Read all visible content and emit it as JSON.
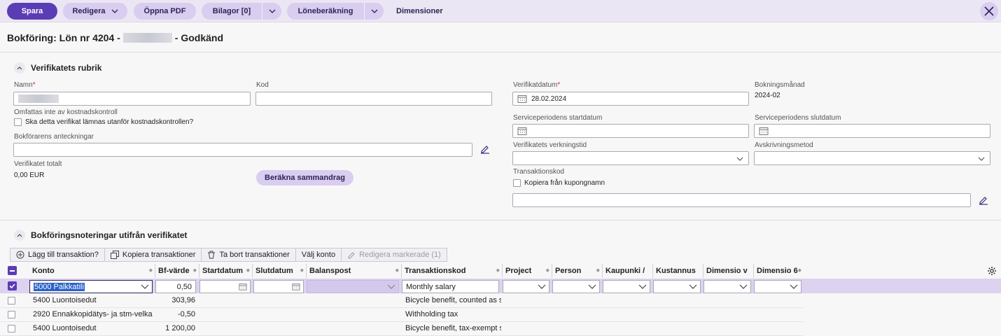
{
  "toolbar": {
    "save": "Spara",
    "edit": "Redigera",
    "open_pdf": "Öppna PDF",
    "attachments": "Bilagor [0]",
    "salary_calc": "Löneberäkning",
    "dimensions": "Dimensioner"
  },
  "page": {
    "title_prefix": "Bokföring: Lön nr 4204 -",
    "title_suffix": "- Godkänd"
  },
  "header_section": {
    "title": "Verifikatets rubrik",
    "name_label": "Namn",
    "code_label": "Kod",
    "code_value": "",
    "cost_control_label": "Omfattas inte av kostnadskontroll",
    "cost_control_checkbox": "Ska detta verifikat lämnas utanför kostnadskontrollen?",
    "notes_label": "Bokförarens anteckningar",
    "notes_value": "",
    "total_label": "Verifikatet totalt",
    "total_value": "0,00 EUR",
    "calc_summary": "Beräkna sammandrag",
    "voucher_date_label": "Verifikatdatum",
    "voucher_date_value": "28.02.2024",
    "booking_month_label": "Bokningsmånad",
    "booking_month_value": "2024-02",
    "service_start_label": "Serviceperiodens startdatum",
    "service_end_label": "Serviceperiodens slutdatum",
    "effect_time_label": "Verifikatets verkningstid",
    "depreciation_label": "Avskrivningsmetod",
    "transaction_code_label": "Transaktionskod",
    "copy_coupon_label": "Kopiera från kupongnamn",
    "transaction_code_value": ""
  },
  "entries_section": {
    "title": "Bokföringsnoteringar utifrån verifikatet",
    "buttons": {
      "add": "Lägg till transaktion?",
      "copy": "Kopiera transaktioner",
      "delete": "Ta bort transaktioner",
      "choose_account": "Välj konto",
      "edit_selected": "Redigera markerade (1)"
    },
    "columns": {
      "account": "Konto",
      "value": "Bf-värde",
      "start": "Startdatum",
      "end": "Slutdatum",
      "balance": "Balanspost",
      "tcode": "Transaktionskod",
      "project": "Project",
      "person": "Person",
      "city": "Kaupunki /",
      "cost": "Kustannus",
      "dim_v": "Dimensio v",
      "dim_6": "Dimensio 6"
    },
    "selected_row": {
      "account": "5000 Palkkatili",
      "value": "0,50",
      "tcode": "Monthly salary"
    },
    "rows": [
      {
        "account": "5400 Luontoisedut",
        "value": "303,96",
        "tcode": "Bicycle benefit, counted as s"
      },
      {
        "account": "2920 Ennakkopidätys- ja stm-velka",
        "value": "-0,50",
        "tcode": "Withholding tax"
      },
      {
        "account": "5400 Luontoisedut",
        "value": "1 200,00",
        "tcode": "Bicycle benefit, tax-exempt s"
      }
    ]
  },
  "colors": {
    "primary": "#5a3cb4",
    "accent_light": "#d9cdf0",
    "toolbar_bg": "#ebe6f3",
    "selected_row": "#ddd2f0",
    "required": "#c8323c"
  }
}
